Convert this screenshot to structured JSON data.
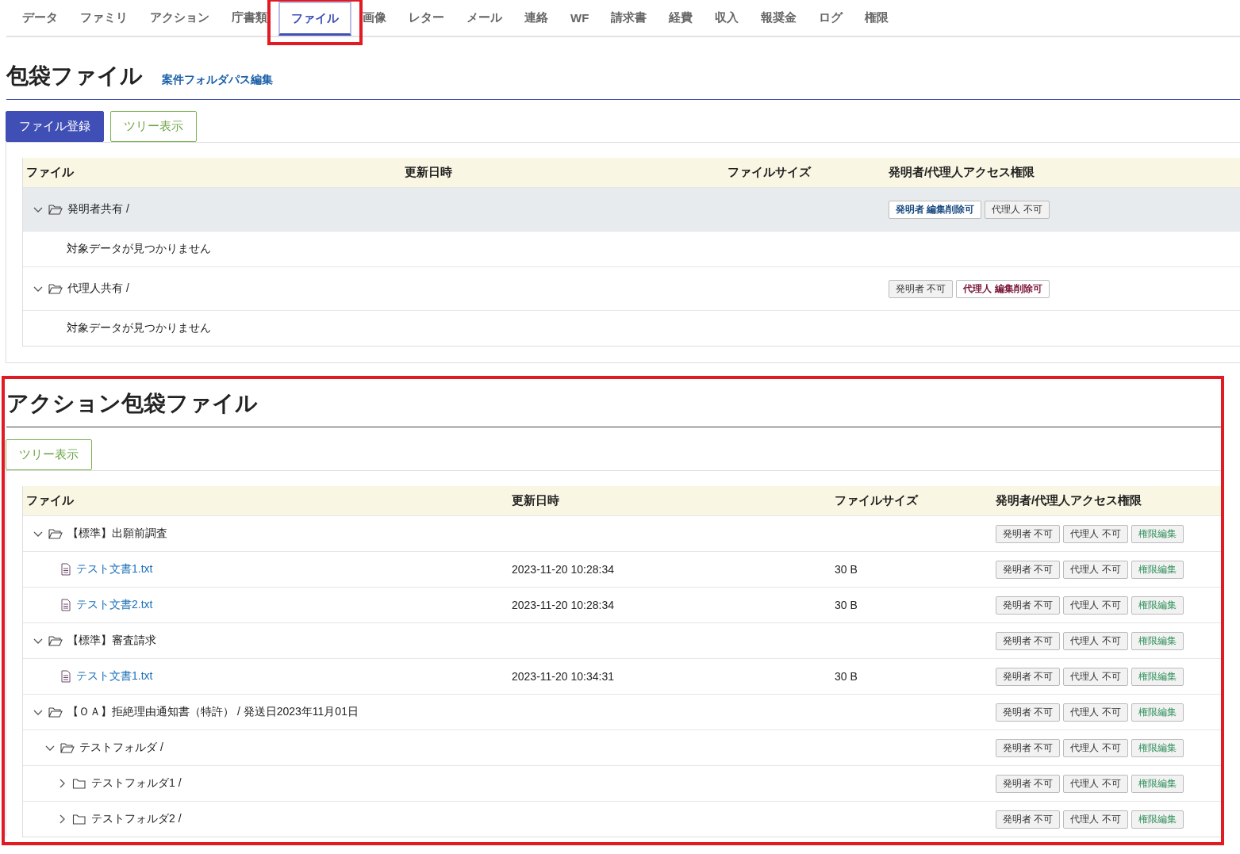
{
  "tabs": [
    {
      "label": "データ",
      "selected": false,
      "highlighted": false
    },
    {
      "label": "ファミリ",
      "selected": false,
      "highlighted": false
    },
    {
      "label": "アクション",
      "selected": false,
      "highlighted": false
    },
    {
      "label": "庁書類",
      "selected": false,
      "highlighted": false
    },
    {
      "label": "ファイル",
      "selected": true,
      "highlighted": true
    },
    {
      "label": "画像",
      "selected": false,
      "highlighted": false
    },
    {
      "label": "レター",
      "selected": false,
      "highlighted": false
    },
    {
      "label": "メール",
      "selected": false,
      "highlighted": false
    },
    {
      "label": "連絡",
      "selected": false,
      "highlighted": false
    },
    {
      "label": "WF",
      "selected": false,
      "highlighted": false
    },
    {
      "label": "請求書",
      "selected": false,
      "highlighted": false
    },
    {
      "label": "経費",
      "selected": false,
      "highlighted": false
    },
    {
      "label": "収入",
      "selected": false,
      "highlighted": false
    },
    {
      "label": "報奨金",
      "selected": false,
      "highlighted": false
    },
    {
      "label": "ログ",
      "selected": false,
      "highlighted": false
    },
    {
      "label": "権限",
      "selected": false,
      "highlighted": false
    }
  ],
  "sections": [
    {
      "title": "包袋ファイル",
      "link": "案件フォルダパス編集",
      "highlighted": false,
      "buttons": [
        {
          "label": "ファイル登録",
          "kind": "primary"
        },
        {
          "label": "ツリー表示",
          "kind": "outline"
        }
      ],
      "columns": [
        "ファイル",
        "更新日時",
        "ファイルサイズ",
        "発明者/代理人アクセス権限"
      ],
      "rows": [
        {
          "kind": "folder",
          "name": "発明者共有 /",
          "expanded": true,
          "selected": true,
          "badges": [
            {
              "label": "発明者 編集削除可",
              "kind": "allowed",
              "color": "#1a4a80"
            },
            {
              "label": "代理人 不可",
              "kind": "denied"
            }
          ],
          "children": [
            {
              "kind": "empty",
              "text": "対象データが見つかりません",
              "selected": false
            }
          ]
        },
        {
          "kind": "folder",
          "name": "代理人共有 /",
          "expanded": true,
          "selected": false,
          "badges": [
            {
              "label": "発明者 不可",
              "kind": "denied"
            },
            {
              "label": "代理人 編集削除可",
              "kind": "allowed",
              "color": "#7a1535"
            }
          ],
          "children": [
            {
              "kind": "empty",
              "text": "対象データが見つかりません",
              "selected": false
            }
          ]
        }
      ]
    },
    {
      "title": "アクション包袋ファイル",
      "highlighted": true,
      "buttons": [
        {
          "label": "ツリー表示",
          "kind": "outline"
        }
      ],
      "columns": [
        "ファイル",
        "更新日時",
        "ファイルサイズ",
        "発明者/代理人アクセス権限"
      ],
      "rows": [
        {
          "kind": "folder",
          "name": "【標準】出願前調査",
          "expanded": true,
          "selected": false,
          "badges": [
            {
              "label": "発明者 不可",
              "kind": "denied"
            },
            {
              "label": "代理人 不可",
              "kind": "denied"
            },
            {
              "label": "権限編集",
              "kind": "edit"
            }
          ],
          "children": [
            {
              "kind": "file",
              "name": "テスト文書1.txt",
              "updated": "2023-11-20 10:28:34",
              "size": "30 B",
              "selected": false,
              "badges": [
                {
                  "label": "発明者 不可",
                  "kind": "denied"
                },
                {
                  "label": "代理人 不可",
                  "kind": "denied"
                },
                {
                  "label": "権限編集",
                  "kind": "edit"
                }
              ]
            },
            {
              "kind": "file",
              "name": "テスト文書2.txt",
              "updated": "2023-11-20 10:28:34",
              "size": "30 B",
              "selected": false,
              "badges": [
                {
                  "label": "発明者 不可",
                  "kind": "denied"
                },
                {
                  "label": "代理人 不可",
                  "kind": "denied"
                },
                {
                  "label": "権限編集",
                  "kind": "edit"
                }
              ]
            }
          ]
        },
        {
          "kind": "folder",
          "name": "【標準】審査請求",
          "expanded": true,
          "selected": false,
          "badges": [
            {
              "label": "発明者 不可",
              "kind": "denied"
            },
            {
              "label": "代理人 不可",
              "kind": "denied"
            },
            {
              "label": "権限編集",
              "kind": "edit"
            }
          ],
          "children": [
            {
              "kind": "file",
              "name": "テスト文書1.txt",
              "updated": "2023-11-20 10:34:31",
              "size": "30 B",
              "selected": false,
              "badges": [
                {
                  "label": "発明者 不可",
                  "kind": "denied"
                },
                {
                  "label": "代理人 不可",
                  "kind": "denied"
                },
                {
                  "label": "権限編集",
                  "kind": "edit"
                }
              ]
            }
          ]
        },
        {
          "kind": "folder",
          "name": "【ＯＡ】拒絶理由通知書（特許） / 発送日2023年11月01日",
          "expanded": true,
          "selected": false,
          "badges": [
            {
              "label": "発明者 不可",
              "kind": "denied"
            },
            {
              "label": "代理人 不可",
              "kind": "denied"
            },
            {
              "label": "権限編集",
              "kind": "edit"
            }
          ],
          "children": [
            {
              "kind": "folder",
              "name": "テストフォルダ /",
              "expanded": true,
              "selected": false,
              "badges": [
                {
                  "label": "発明者 不可",
                  "kind": "denied"
                },
                {
                  "label": "代理人 不可",
                  "kind": "denied"
                },
                {
                  "label": "権限編集",
                  "kind": "edit"
                }
              ],
              "children": [
                {
                  "kind": "folder",
                  "name": "テストフォルダ1 /",
                  "expanded": false,
                  "selected": false,
                  "badges": [
                    {
                      "label": "発明者 不可",
                      "kind": "denied"
                    },
                    {
                      "label": "代理人 不可",
                      "kind": "denied"
                    },
                    {
                      "label": "権限編集",
                      "kind": "edit"
                    }
                  ]
                },
                {
                  "kind": "folder",
                  "name": "テストフォルダ2 /",
                  "expanded": false,
                  "selected": false,
                  "badges": [
                    {
                      "label": "発明者 不可",
                      "kind": "denied"
                    },
                    {
                      "label": "代理人 不可",
                      "kind": "denied"
                    },
                    {
                      "label": "権限編集",
                      "kind": "edit"
                    }
                  ]
                }
              ]
            }
          ]
        }
      ]
    }
  ]
}
